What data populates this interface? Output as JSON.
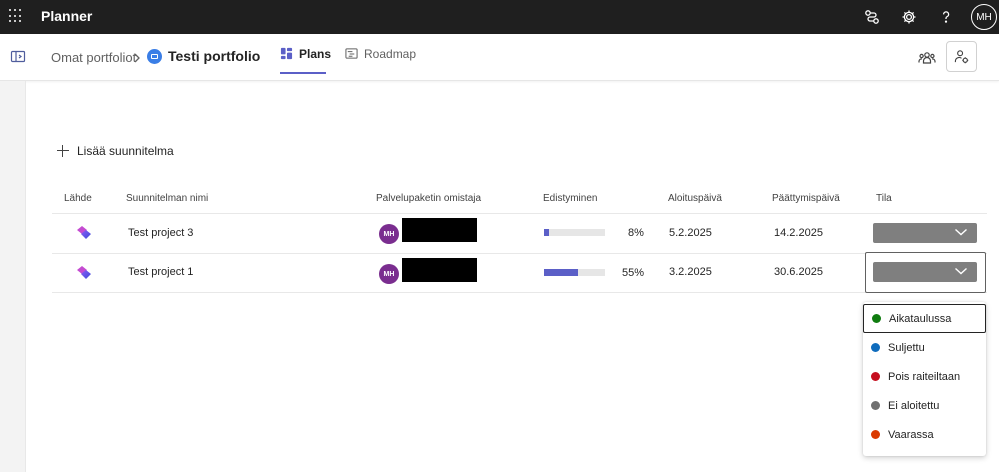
{
  "app": {
    "title": "Planner",
    "user_initials": "MH"
  },
  "topbar_icons": [
    "connections-icon",
    "gear-icon",
    "help-icon"
  ],
  "breadcrumb": {
    "root": "Omat portfoliot",
    "current": "Testi portfolio"
  },
  "tabs": [
    {
      "label": "Plans",
      "active": true,
      "icon": "board-icon"
    },
    {
      "label": "Roadmap",
      "active": false,
      "icon": "roadmap-icon"
    }
  ],
  "actions": {
    "add_plan": "Lisää suunnitelma"
  },
  "table": {
    "headers": {
      "source": "Lähde",
      "name": "Suunnitelman nimi",
      "owner": "Palvelupaketin omistaja",
      "progress": "Edistyminen",
      "start": "Aloituspäivä",
      "end": "Päättymispäivä",
      "status": "Tila"
    },
    "rows": [
      {
        "name": "Test project 3",
        "owner_initials": "MH",
        "progress": 8,
        "progress_label": "8%",
        "start": "5.2.2025",
        "end": "14.2.2025"
      },
      {
        "name": "Test project 1",
        "owner_initials": "MH",
        "progress": 55,
        "progress_label": "55%",
        "start": "3.2.2025",
        "end": "30.6.2025"
      }
    ]
  },
  "status_menu": {
    "options": [
      {
        "label": "Aikataulussa",
        "color": "#107c10",
        "selected": true
      },
      {
        "label": "Suljettu",
        "color": "#0f6cbd",
        "selected": false
      },
      {
        "label": "Pois raiteiltaan",
        "color": "#c50f1f",
        "selected": false
      },
      {
        "label": "Ei aloitettu",
        "color": "#707070",
        "selected": false
      },
      {
        "label": "Vaarassa",
        "color": "#da3b01",
        "selected": false
      }
    ]
  },
  "colors": {
    "accent": "#5b5fc7",
    "topbar": "#1f1f1f",
    "owner_avatar": "#7a2d8f",
    "status_box": "#7f7f7f"
  }
}
